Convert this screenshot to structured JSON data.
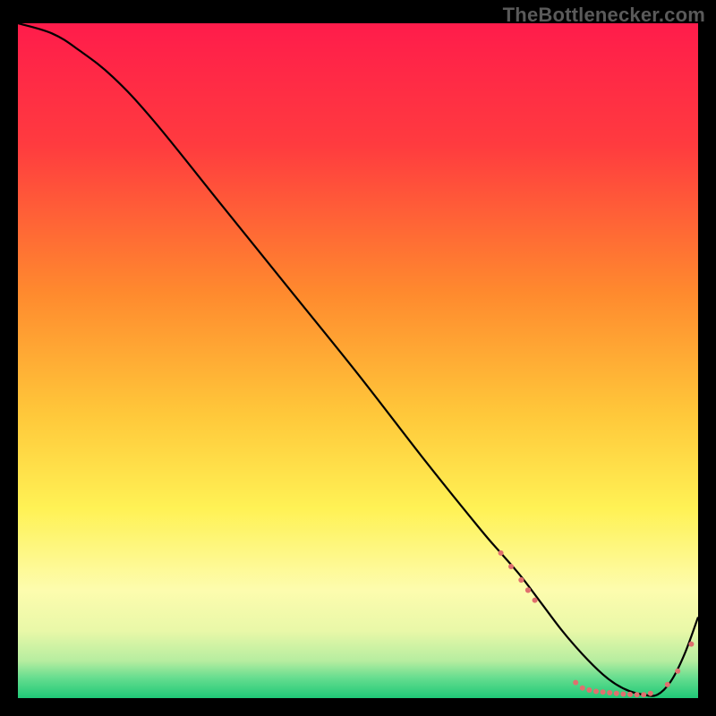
{
  "attribution": "TheBottlenecker.com",
  "colors": {
    "bg": "#000000",
    "attribution_text": "#5a5a5a",
    "curve": "#000000",
    "marker_fill": "#e0706e",
    "marker_stroke": "#cf5a58",
    "gradient_top": "#ff1c4b",
    "gradient_mid_upper": "#ffb83a",
    "gradient_mid": "#fff255",
    "gradient_band": "#fcfccf",
    "gradient_bottom": "#1fd07b"
  },
  "chart_data": {
    "type": "line",
    "title": "",
    "xlabel": "",
    "ylabel": "",
    "xlim": [
      0,
      100
    ],
    "ylim": [
      0,
      100
    ],
    "grid": false,
    "legend": false,
    "series": [
      {
        "name": "curve",
        "x": [
          0,
          5,
          9,
          14,
          20,
          30,
          40,
          50,
          60,
          68,
          71,
          74,
          77,
          80,
          83,
          86,
          88,
          90,
          92,
          94,
          96,
          98,
          100
        ],
        "y": [
          100,
          98.5,
          96,
          92,
          85.5,
          73,
          60.5,
          48,
          35,
          25,
          21.5,
          18,
          14,
          10,
          6.5,
          3.5,
          2,
          1,
          0.5,
          0.5,
          2.5,
          6.5,
          12
        ]
      }
    ],
    "markers": [
      {
        "x": 71,
        "y": 21.5,
        "r": 1.1
      },
      {
        "x": 72.5,
        "y": 19.5,
        "r": 1.2
      },
      {
        "x": 74,
        "y": 17.5,
        "r": 1.3
      },
      {
        "x": 75,
        "y": 16,
        "r": 1.3
      },
      {
        "x": 76,
        "y": 14.5,
        "r": 1.2
      },
      {
        "x": 82,
        "y": 2.3,
        "r": 1.0
      },
      {
        "x": 83,
        "y": 1.5,
        "r": 1.0
      },
      {
        "x": 84,
        "y": 1.2,
        "r": 1.0
      },
      {
        "x": 85,
        "y": 1.0,
        "r": 1.0
      },
      {
        "x": 86,
        "y": 0.9,
        "r": 1.0
      },
      {
        "x": 87,
        "y": 0.8,
        "r": 1.0
      },
      {
        "x": 88,
        "y": 0.7,
        "r": 1.0
      },
      {
        "x": 89,
        "y": 0.6,
        "r": 1.0
      },
      {
        "x": 90,
        "y": 0.55,
        "r": 1.0
      },
      {
        "x": 91,
        "y": 0.5,
        "r": 1.0
      },
      {
        "x": 92,
        "y": 0.5,
        "r": 1.0
      },
      {
        "x": 93,
        "y": 0.7,
        "r": 1.0
      },
      {
        "x": 95.5,
        "y": 2.0,
        "r": 1.0
      },
      {
        "x": 97,
        "y": 4.0,
        "r": 1.0
      },
      {
        "x": 99,
        "y": 8.0,
        "r": 1.0
      }
    ],
    "gradient_stops": [
      {
        "offset": 0.0,
        "color": "#ff1c4b"
      },
      {
        "offset": 0.18,
        "color": "#ff3b3f"
      },
      {
        "offset": 0.4,
        "color": "#ff8a2e"
      },
      {
        "offset": 0.58,
        "color": "#ffc83a"
      },
      {
        "offset": 0.72,
        "color": "#fff255"
      },
      {
        "offset": 0.84,
        "color": "#fdfcae"
      },
      {
        "offset": 0.9,
        "color": "#e9f8a8"
      },
      {
        "offset": 0.945,
        "color": "#b6eda0"
      },
      {
        "offset": 0.97,
        "color": "#66dd8f"
      },
      {
        "offset": 1.0,
        "color": "#1fc977"
      }
    ]
  }
}
